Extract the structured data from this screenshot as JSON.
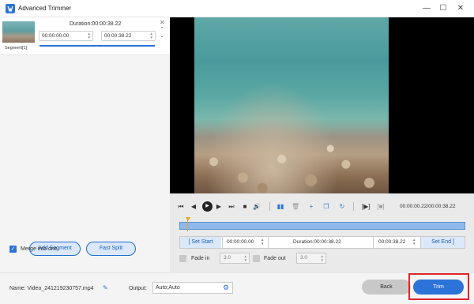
{
  "window": {
    "title": "Advanced Trimmer"
  },
  "segment": {
    "name": "Segment[1]",
    "duration": "Duration:00:00:38.22",
    "start": "00:00:00.00",
    "end": "00:00:38.22"
  },
  "left_buttons": {
    "add_segment": "Add Segment",
    "fast_split": "Fast Split"
  },
  "merge": {
    "label": "Merge into one",
    "checked": true
  },
  "player": {
    "time_readout": "00:00:00.22/00:00:38.22",
    "playhead_fraction": 0.02
  },
  "edit": {
    "set_start": "Set Start",
    "start_time": "00:00:00.00",
    "duration": "Duration:00:00:38.22",
    "end_time": "00:00:38.22",
    "set_end": "Set End"
  },
  "fade": {
    "fade_in": "Fade in",
    "fade_in_value": "3.0",
    "fade_out": "Fade out",
    "fade_out_value": "3.0"
  },
  "bottom": {
    "name": "Name: Video_241219230757.mp4",
    "output_label": "Output:",
    "output_value": "Auto;Auto",
    "back": "Back",
    "trim": "Trim"
  },
  "colors": {
    "accent": "#2b73d8",
    "highlight": "#e0262a"
  }
}
